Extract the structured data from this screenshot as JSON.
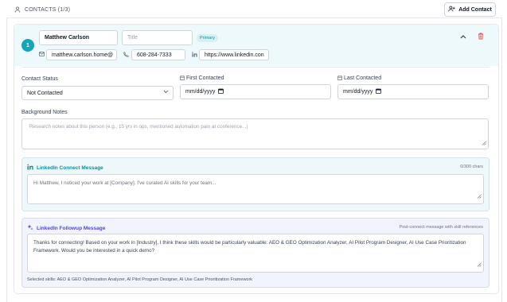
{
  "section": {
    "title": "CONTACTS (1/3)",
    "add_button": "Add Contact"
  },
  "contact": {
    "index": "1",
    "name": "Matthew Carlson",
    "title_placeholder": "Title",
    "primary_badge": "Primary",
    "email": "matthew.carlson.home@",
    "phone": "608-284-7333",
    "linkedin": "https://www.linkedin.con"
  },
  "status": {
    "label": "Contact Status",
    "value": "Not Contacted"
  },
  "dates": {
    "first_label": "First Contacted",
    "first_value": "mm/dd/yyyy",
    "last_label": "Last Contacted",
    "last_value": "mm/dd/yyyy"
  },
  "notes": {
    "label": "Background Notes",
    "placeholder": "Research notes about this person (e.g., 15 yrs in ops, mentioned automation pain at conference...)"
  },
  "connect_message": {
    "title": "LinkedIn Connect Message",
    "char_count": "0/300 chars",
    "text": "Hi Matthew, I noticed your work at [Company]. I've curated AI skills for your team..."
  },
  "followup_message": {
    "title": "LinkedIn Followup Message",
    "aside": "Post-connect message with skill references",
    "text": "Thanks for connecting! Based on your work in [Industry], I think these skills would be particularly valuable: AEO & GEO Optimization Analyzer, AI Pilot Program Designer, AI Use Case Prioritization Framework. Would you be interested in a quick demo?",
    "skills_line": "Selected skills: AEO & GEO Optimization Analyzer, AI Pilot Program Designer, AI Use Case Prioritization Framework"
  },
  "colors": {
    "accent": "#14a6b8",
    "connect_title": "#0e8ea0",
    "followup_title": "#4f46e5",
    "delete": "#ef4444"
  },
  "icons": [
    "person-icon",
    "user-plus-icon",
    "mail-icon",
    "phone-icon",
    "linkedin-icon",
    "calendar-icon",
    "chevron-up-icon",
    "chevron-down-icon",
    "trash-icon",
    "sparkle-icon",
    "resize-handle-icon"
  ]
}
